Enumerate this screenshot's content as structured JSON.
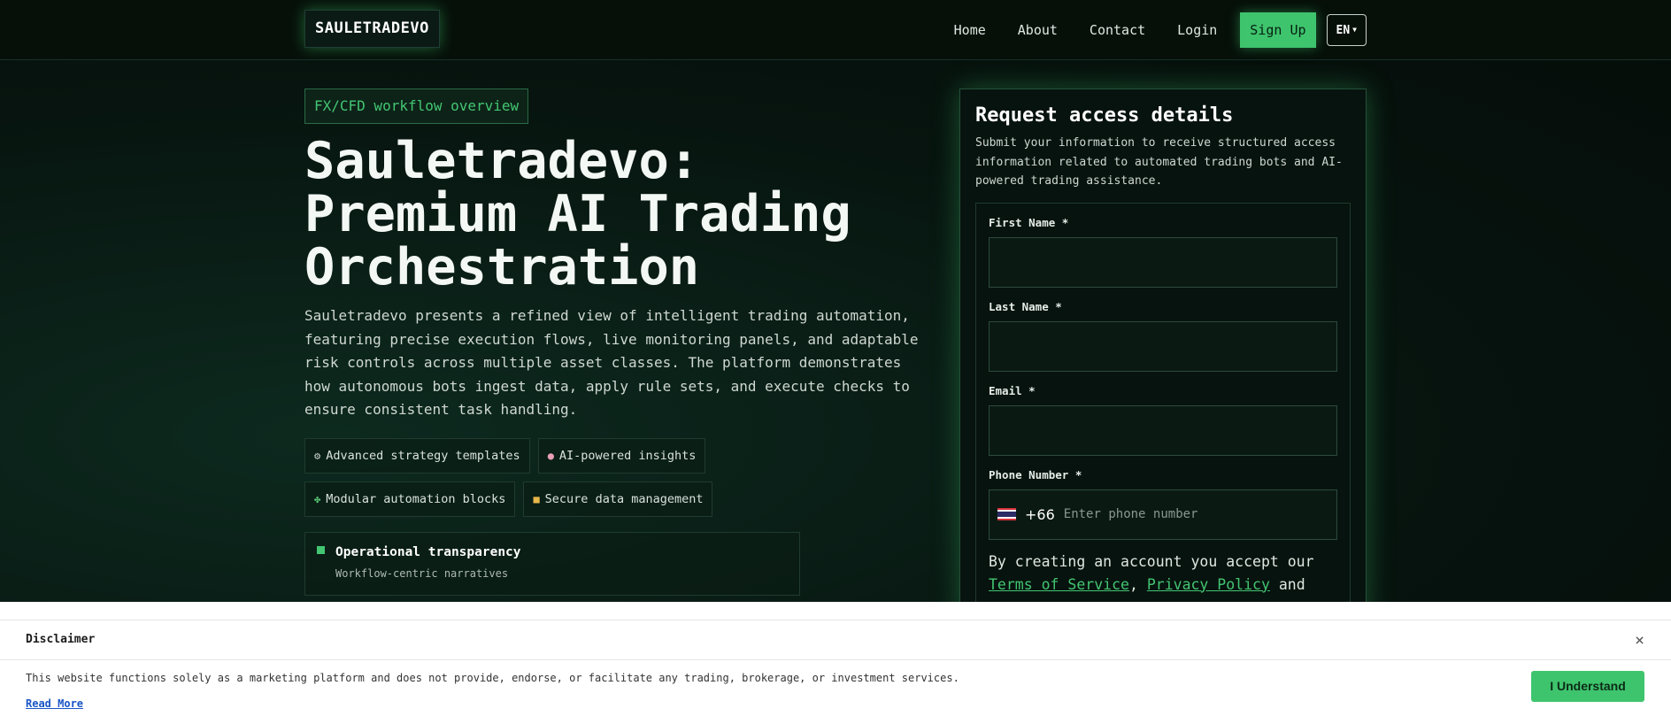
{
  "header": {
    "logo": "SAULETRADEVO",
    "nav": [
      "Home",
      "About",
      "Contact",
      "Login"
    ],
    "signup_label": "Sign Up",
    "lang_label": "EN"
  },
  "hero": {
    "tag": "FX/CFD workflow overview",
    "title": "Sauletradevo: Premium AI Trading Orchestration",
    "description": "Sauletradevo presents a refined view of intelligent trading automation, featuring precise execution flows, live monitoring panels, and adaptable risk controls across multiple asset classes. The platform demonstrates how autonomous bots ingest data, apply rule sets, and execute checks to ensure consistent task handling.",
    "features": [
      {
        "icon": "gear-icon",
        "label": "Advanced strategy templates"
      },
      {
        "icon": "brain-icon",
        "label": "AI-powered insights"
      },
      {
        "icon": "puzzle-icon",
        "label": "Modular automation blocks"
      },
      {
        "icon": "lock-icon",
        "label": "Secure data management"
      }
    ],
    "panel": {
      "title": "Operational transparency",
      "subtitle": "Workflow-centric narratives"
    }
  },
  "form": {
    "title": "Request access details",
    "description": "Submit your information to receive structured access information related to automated trading bots and AI-powered trading assistance.",
    "first_name_label": "First Name *",
    "last_name_label": "Last Name *",
    "email_label": "Email *",
    "phone_label": "Phone Number *",
    "phone_code": "+66",
    "phone_placeholder": "Enter phone number",
    "terms_prefix": "By creating an account you accept our",
    "terms_link": "Terms of Service",
    "terms_sep": ",",
    "privacy_link": "Privacy Policy",
    "terms_suffix": "and"
  },
  "disclaimer": {
    "title": "Disclaimer",
    "close": "×",
    "text": "This website functions solely as a marketing platform and does not provide, endorse, or facilitate any trading, brokerage, or investment services.",
    "read_more": "Read More",
    "accept_label": "I Understand"
  },
  "colors": {
    "accent": "#3ec46d",
    "background": "#07140f",
    "banner": "#ffffff"
  }
}
